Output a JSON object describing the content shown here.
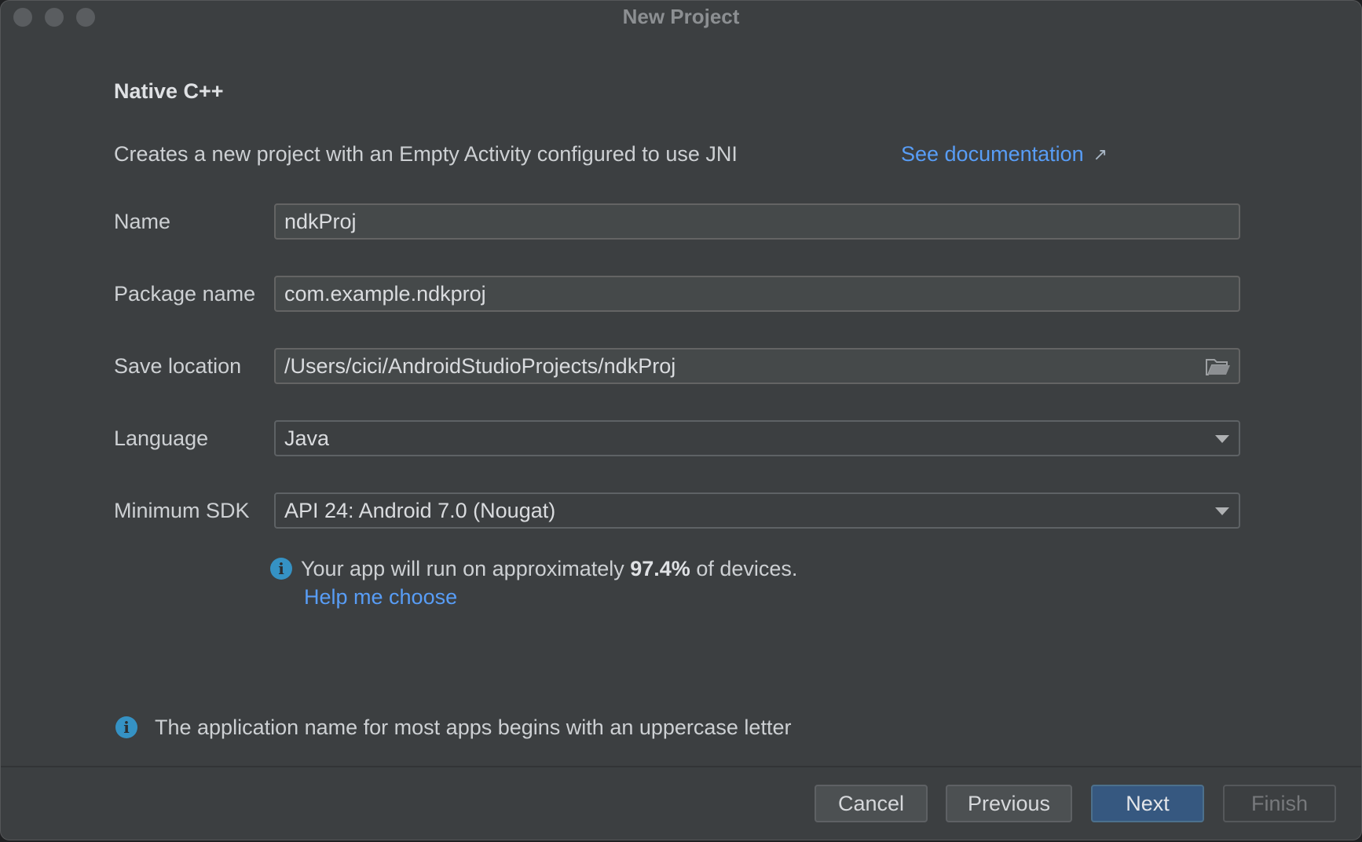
{
  "window": {
    "title": "New Project"
  },
  "header": {
    "title": "Native C++",
    "description": "Creates a new project with an Empty Activity configured to use JNI",
    "doc_link": "See documentation",
    "doc_link_icon": "external-link-icon"
  },
  "form": {
    "name": {
      "label": "Name",
      "value": "ndkProj"
    },
    "package_name": {
      "label": "Package name",
      "value": "com.example.ndkproj"
    },
    "save_location": {
      "label": "Save location",
      "value": "/Users/cici/AndroidStudioProjects/ndkProj",
      "icon": "folder-icon"
    },
    "language": {
      "label": "Language",
      "value": "Java"
    },
    "minimum_sdk": {
      "label": "Minimum SDK",
      "value": "API 24: Android 7.0 (Nougat)"
    }
  },
  "sdk_info": {
    "text_before": "Your app will run on approximately ",
    "percentage": "97.4%",
    "text_after": " of devices.",
    "help_link": "Help me choose"
  },
  "hint": {
    "text": "The application name for most apps begins with an uppercase letter"
  },
  "buttons": {
    "cancel": "Cancel",
    "previous": "Previous",
    "next": "Next",
    "finish": "Finish"
  },
  "colors": {
    "background": "#3c3f41",
    "link": "#589df6",
    "primary_button": "#365880",
    "info_icon": "#3592c4"
  }
}
